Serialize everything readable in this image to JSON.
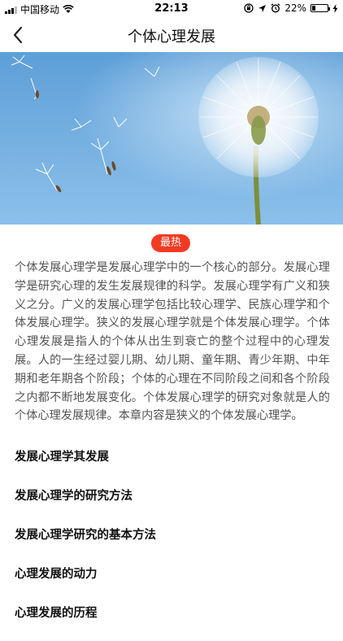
{
  "status_bar": {
    "carrier": "中国移动",
    "time": "22:13",
    "battery_percent": "22%",
    "battery_level": 0.22
  },
  "nav": {
    "title": "个体心理发展",
    "back_icon": "chevron-left-icon"
  },
  "hero": {
    "icon": "dandelion-image",
    "sky_color": "#6aa7dc"
  },
  "badge": {
    "label": "最热",
    "color": "#f23a22"
  },
  "intro": {
    "text": "个体发展心理学是发展心理学中的一个核心的部分。发展心理学是研究心理的发生发展规律的科学。发展心理学有广义和狭义之分。广义的发展心理学包括比较心理学、民族心理学和个体发展心理学。狭义的发展心理学就是个体发展心理学。个体心理发展是指人的个体从出生到衰亡的整个过程中的心理发展。人的一生经过婴儿期、幼儿期、童年期、青少年期、中年期和老年期各个阶段；个体的心理在不同阶段之间和各个阶段之内都不断地发展变化。个体发展心理学的研究对象就是人的个体心理发展规律。本章内容是狭义的个体发展心理学。"
  },
  "chapters": [
    {
      "label": "发展心理学其发展"
    },
    {
      "label": "发展心理学的研究方法"
    },
    {
      "label": "发展心理学研究的基本方法"
    },
    {
      "label": "心理发展的动力"
    },
    {
      "label": "心理发展的历程"
    }
  ]
}
